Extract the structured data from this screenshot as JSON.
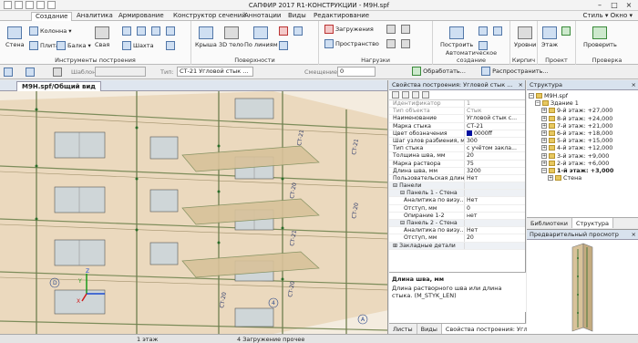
{
  "app": {
    "title": "САПФИР 2017 R1-КОНСТРУКЦИИ - М9Н.spf",
    "style_label": "Стиль",
    "window_label": "Окно"
  },
  "ribbon_tabs": [
    "Создание",
    "Аналитика",
    "Армирование",
    "Конструктор сечений",
    "Аннотации",
    "Виды",
    "Редактирование"
  ],
  "ribbon": {
    "groups": {
      "tools": "Инструменты построения",
      "surfaces": "Поверхности",
      "loads": "Нагрузки",
      "auto": "Автоматическое создание",
      "brick": "Кирпич",
      "project": "Проект",
      "check": "Проверка"
    },
    "buttons": {
      "column": "Колонна",
      "wall": "Стена",
      "slab": "Плита",
      "beam": "Балка",
      "pile": "Свая",
      "shaft": "Шахта",
      "roof": "Крыша",
      "body3d": "3D тело",
      "by_lines": "По линиям",
      "loads": "Загружения",
      "space": "Пространство",
      "build": "Построить",
      "levels": "Уровни",
      "floor": "Этаж",
      "verify": "Проверить"
    }
  },
  "propbar": {
    "template_label": "Шаблон:",
    "type_label": "Тип:",
    "type_value": "СТ-21 Угловой стык ...",
    "offset_label": "Смещение :",
    "offset_value": "0",
    "process_button": "Обработать...",
    "distribute_button": "Распространить..."
  },
  "viewport": {
    "tab_label": "М9Н.spf/Общий вид"
  },
  "properties": {
    "header": "Свойства построения: Угловой стык ...",
    "rows": [
      {
        "k": "Идентификатор",
        "v": "1",
        "style": "dim"
      },
      {
        "k": "Тип объекта",
        "v": "Стык",
        "style": "dim"
      },
      {
        "k": "Наименование",
        "v": "Угловой стык с...",
        "style": ""
      },
      {
        "k": "Марка стыка",
        "v": "СТ-21",
        "style": ""
      },
      {
        "k": "Цвет обозначения",
        "v": "0000ff",
        "style": "color"
      },
      {
        "k": "Шаг узлов разбиения, мм",
        "v": "300",
        "style": ""
      },
      {
        "k": "Тип стыка",
        "v": "с учётом закла...",
        "style": ""
      },
      {
        "k": "Толщина шва, мм",
        "v": "20",
        "style": ""
      },
      {
        "k": "Марка раствора",
        "v": "75",
        "style": ""
      },
      {
        "k": "Длина шва, мм",
        "v": "3200",
        "style": ""
      },
      {
        "k": "Пользовательская длин...",
        "v": "Нет",
        "style": ""
      },
      {
        "k": "⊟ Панели",
        "v": "",
        "style": "cat"
      },
      {
        "k": "⊟ Панель 1 - Стена",
        "v": "",
        "style": "cat sub"
      },
      {
        "k": "Аналитика по визу...",
        "v": "Нет",
        "style": "sub2"
      },
      {
        "k": "Отступ, мм",
        "v": "0",
        "style": "sub2"
      },
      {
        "k": "Опирание 1-2",
        "v": "нет",
        "style": "sub2"
      },
      {
        "k": "⊟ Панель 2 - Стена",
        "v": "",
        "style": "cat sub"
      },
      {
        "k": "Аналитика по визу...",
        "v": "Нет",
        "style": "sub2"
      },
      {
        "k": "Отступ, мм",
        "v": "20",
        "style": "sub2"
      },
      {
        "k": "⊞ Закладные детали",
        "v": "",
        "style": "cat"
      }
    ],
    "desc_title": "Длина шва, мм",
    "desc_text": "Длина растворного шва или длина стыка. (M_STYK_LEN)",
    "bottom_tabs": [
      "Листы",
      "Виды",
      "Свойства построения: Угл..."
    ]
  },
  "structure": {
    "header": "Структура",
    "nodes": [
      {
        "label": "М9Н.spf",
        "depth": 0,
        "exp": "−"
      },
      {
        "label": "Здание 1",
        "depth": 1,
        "exp": "−"
      },
      {
        "label": "9-й этаж: +27,000",
        "depth": 2,
        "exp": "+"
      },
      {
        "label": "8-й этаж: +24,000",
        "depth": 2,
        "exp": "+"
      },
      {
        "label": "7-й этаж: +21,000",
        "depth": 2,
        "exp": "+"
      },
      {
        "label": "6-й этаж: +18,000",
        "depth": 2,
        "exp": "+"
      },
      {
        "label": "5-й этаж: +15,000",
        "depth": 2,
        "exp": "+"
      },
      {
        "label": "4-й этаж: +12,000",
        "depth": 2,
        "exp": "+"
      },
      {
        "label": "3-й этаж: +9,000",
        "depth": 2,
        "exp": "+"
      },
      {
        "label": "2-й этаж: +6,000",
        "depth": 2,
        "exp": "+"
      },
      {
        "label": "1-й этаж: +3,000",
        "depth": 2,
        "exp": "−",
        "bold": true
      },
      {
        "label": "Стена",
        "depth": 3,
        "exp": "+"
      }
    ],
    "tabs": [
      "Библиотеки",
      "Структура"
    ]
  },
  "preview": {
    "header": "Предварительный просмотр"
  },
  "viewport_labels": [
    "СТ-21",
    "СТ-20",
    "СТ-21",
    "СТ-20",
    "СТ-21",
    "СТ-20",
    "СТ-20",
    "4",
    "D",
    "A"
  ],
  "statusbar": {
    "floor": "1 этаж",
    "load": "4 Загружение прочее"
  }
}
